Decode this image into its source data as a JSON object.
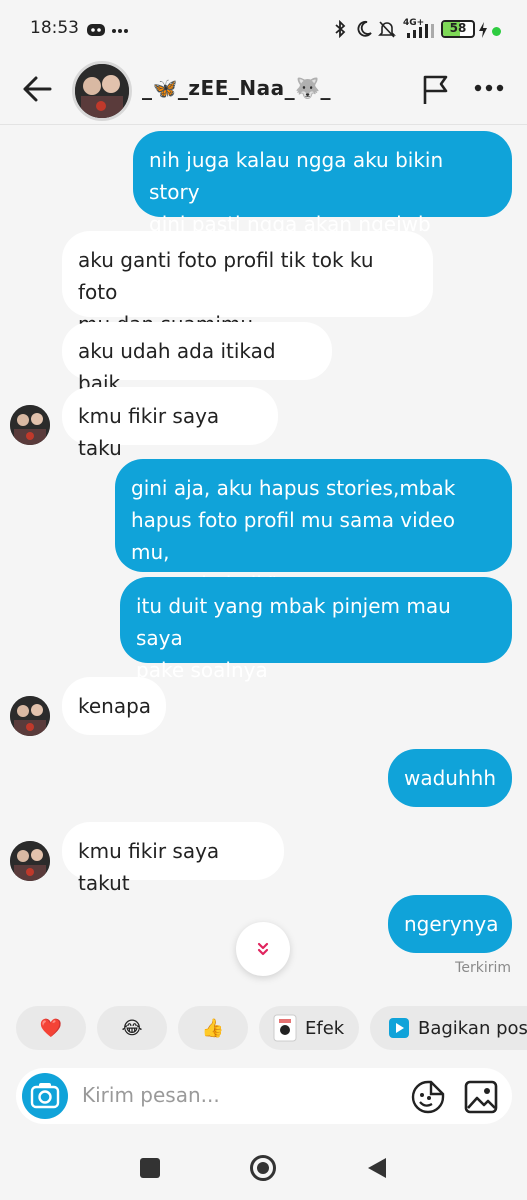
{
  "status_bar": {
    "time": "18:53",
    "network": "4G+",
    "battery": "58",
    "battery_level": 0.58
  },
  "header": {
    "contact_name": "_🦋_zEE_Naa_🐺_"
  },
  "messages": [
    {
      "side": "out",
      "text": "nih juga kalau ngga aku bikin story\ngini pasti ngga akan ngejwb"
    },
    {
      "side": "in",
      "text": "aku ganti foto profil tik tok ku foto\nmu dan suamimu"
    },
    {
      "side": "in",
      "text": "aku udah ada itikad baik"
    },
    {
      "side": "in",
      "text": "kmu fikir saya taku"
    },
    {
      "side": "out",
      "text": "gini aja, aku hapus stories,mbak\nhapus foto profil mu sama video mu,\nngmngin baik\""
    },
    {
      "side": "out",
      "text": "itu duit yang mbak pinjem mau saya\npake soalnya"
    },
    {
      "side": "in",
      "text": "kenapa"
    },
    {
      "side": "out",
      "text": "waduhhh"
    },
    {
      "side": "in",
      "text": "kmu fikir saya takut"
    },
    {
      "side": "out",
      "text": "ngerynya"
    }
  ],
  "sent_status": "Terkirim",
  "quick_reactions": {
    "heart": "❤️",
    "laugh": "😂",
    "thumbs": "👍",
    "effect_label": "Efek",
    "share_label": "Bagikan post"
  },
  "composer": {
    "placeholder": "Kirim pesan..."
  },
  "colors": {
    "outgoing_bubble": "#10a3d9",
    "incoming_bubble": "#ffffff",
    "background": "#f5f5f5"
  }
}
